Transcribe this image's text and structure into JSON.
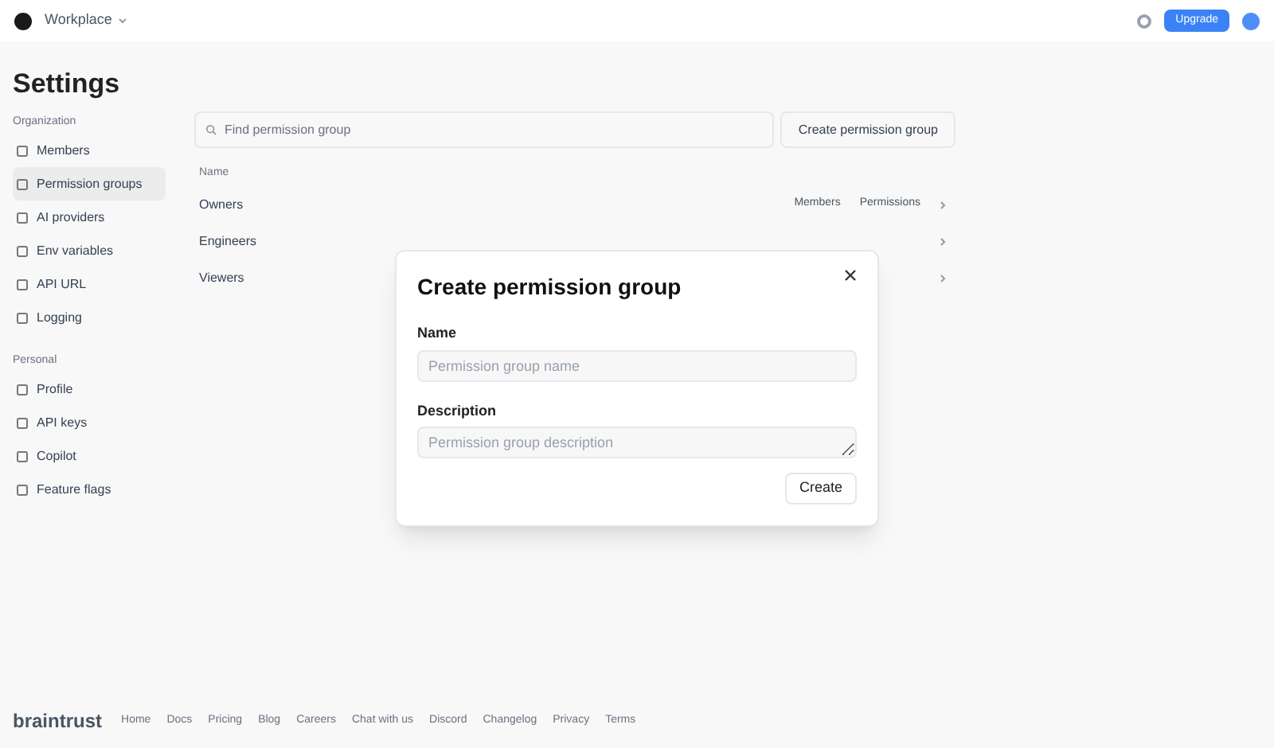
{
  "header": {
    "workspace": "Workplace",
    "upgrade": "Upgrade"
  },
  "page_title": "Settings",
  "sidebar": [
    {
      "section": "Organization",
      "items": [
        {
          "label": "Members",
          "selected": false
        },
        {
          "label": "Permission groups",
          "selected": true
        },
        {
          "label": "AI providers",
          "selected": false
        },
        {
          "label": "Env variables",
          "selected": false
        },
        {
          "label": "API URL",
          "selected": false
        },
        {
          "label": "Logging",
          "selected": false
        }
      ]
    },
    {
      "section": "Personal",
      "items": [
        {
          "label": "Profile",
          "selected": false
        },
        {
          "label": "API keys",
          "selected": false
        },
        {
          "label": "Copilot",
          "selected": false
        },
        {
          "label": "Feature flags",
          "selected": false
        }
      ]
    }
  ],
  "search": {
    "placeholder": "Find permission group"
  },
  "create_button": "Create permission group",
  "table": {
    "columns": [
      "Name"
    ],
    "rows": [
      {
        "name": "Owners",
        "actions": [
          "Members",
          "Permissions"
        ]
      },
      {
        "name": "Engineers"
      },
      {
        "name": "Viewers"
      }
    ]
  },
  "footer": {
    "logo": "braintrust",
    "links": [
      "Home",
      "Docs",
      "Pricing",
      "Blog",
      "Careers",
      "Chat with us",
      "Discord",
      "Changelog",
      "Privacy",
      "Terms"
    ]
  },
  "dialog": {
    "title": "Create permission group",
    "fields": [
      {
        "kind": "input",
        "label": "Name",
        "placeholder": "Permission group name"
      },
      {
        "kind": "textarea",
        "label": "Description",
        "placeholder": "Permission group description"
      }
    ],
    "submit": "Create"
  }
}
